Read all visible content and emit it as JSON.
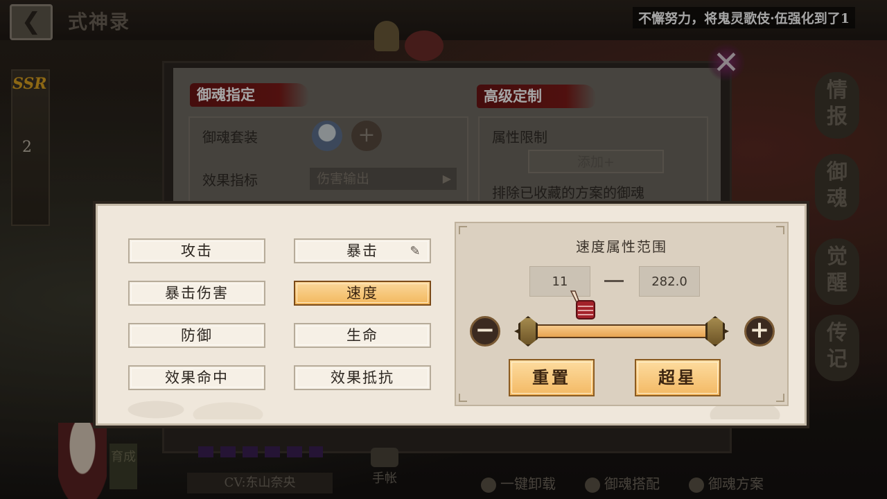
{
  "topbar": {
    "back_icon": "back-arrow-icon",
    "title": "式神录",
    "toast": "不懈努力，将鬼灵歌伎·伍强化到了1"
  },
  "left_panel": {
    "rarity": "SSR",
    "count": "2"
  },
  "right_tabs": [
    {
      "label": "情报"
    },
    {
      "label": "御魂"
    },
    {
      "label": "觉醒"
    },
    {
      "label": "传记"
    }
  ],
  "base_panel": {
    "section_left": "御魂指定",
    "section_right": "高级定制",
    "suit_label": "御魂套装",
    "effect_label": "效果指标",
    "effect_value": "伤害输出",
    "attr_limit_label": "属性限制",
    "add_button": "添加+",
    "exclude_text": "排除已收藏的方案的御魂"
  },
  "popup": {
    "attributes": [
      {
        "label": "攻击",
        "active": false
      },
      {
        "label": "暴击",
        "active": false
      },
      {
        "label": "暴击伤害",
        "active": false
      },
      {
        "label": "速度",
        "active": true
      },
      {
        "label": "防御",
        "active": false
      },
      {
        "label": "生命",
        "active": false
      },
      {
        "label": "效果命中",
        "active": false
      },
      {
        "label": "效果抵抗",
        "active": false
      }
    ],
    "range": {
      "title": "速度属性范围",
      "min": "11",
      "max": "282.0",
      "slider_low": 0.0,
      "slider_high": 1.0
    },
    "reset_button": "重置",
    "super_star_button": "超星"
  },
  "bottom": {
    "foster": "育成",
    "cv": "CV:东山奈央",
    "handbook": "手帐",
    "actions": [
      "一键卸载",
      "御魂搭配",
      "御魂方案"
    ]
  },
  "colors": {
    "accent": "#f2b85d",
    "brush_red": "#7b1a17",
    "popup_bg": "#efe7db"
  }
}
